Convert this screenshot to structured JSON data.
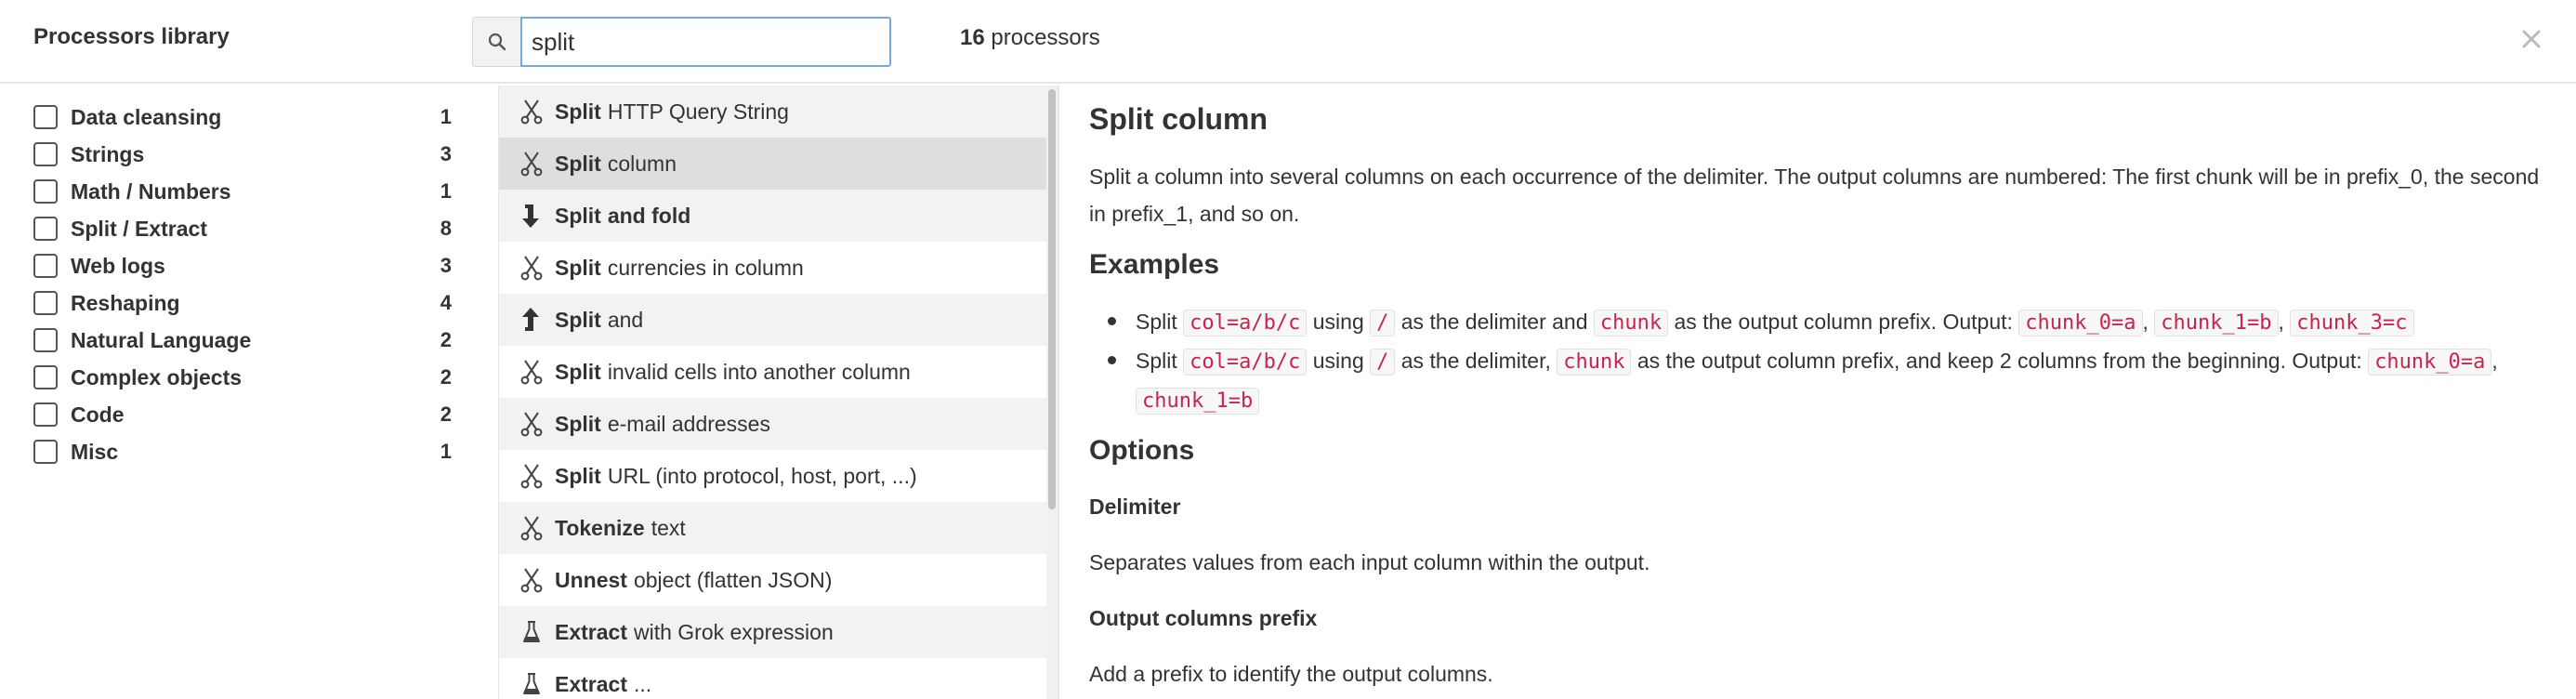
{
  "header": {
    "title": "Processors library",
    "search": {
      "value": "split",
      "placeholder": ""
    },
    "count_number": "16",
    "count_label": "processors",
    "close_icon": "close-icon"
  },
  "categories": [
    {
      "label": "Data cleansing",
      "count": "1"
    },
    {
      "label": "Strings",
      "count": "3"
    },
    {
      "label": "Math / Numbers",
      "count": "1"
    },
    {
      "label": "Split / Extract",
      "count": "8"
    },
    {
      "label": "Web logs",
      "count": "3"
    },
    {
      "label": "Reshaping",
      "count": "4"
    },
    {
      "label": "Natural Language",
      "count": "2"
    },
    {
      "label": "Complex objects",
      "count": "2"
    },
    {
      "label": "Code",
      "count": "2"
    },
    {
      "label": "Misc",
      "count": "1"
    }
  ],
  "processors": [
    {
      "bold": "Split",
      "rest": "HTTP Query String",
      "icon": "scissors-icon"
    },
    {
      "bold": "Split",
      "rest": "column",
      "icon": "scissors-icon"
    },
    {
      "bold": "Split",
      "rest": "and fold",
      "rest_bold": true,
      "icon": "arrow-down-icon"
    },
    {
      "bold": "Split",
      "rest": "currencies in column",
      "icon": "scissors-icon"
    },
    {
      "bold": "Split",
      "rest": "and",
      "icon": "arrow-up-icon"
    },
    {
      "bold": "Split",
      "rest": "invalid cells into another column",
      "icon": "scissors-icon"
    },
    {
      "bold": "Split",
      "rest": "e-mail addresses",
      "icon": "scissors-icon"
    },
    {
      "bold": "Split",
      "rest": "URL (into protocol, host, port, ...)",
      "icon": "scissors-icon"
    },
    {
      "bold": "Tokenize",
      "rest": "text",
      "icon": "scissors-icon"
    },
    {
      "bold": "Unnest",
      "rest": "object (flatten JSON)",
      "icon": "scissors-icon"
    },
    {
      "bold": "Extract",
      "rest": "with Grok expression",
      "icon": "flask-icon"
    },
    {
      "bold": "Extract",
      "rest": "...",
      "icon": "flask-icon"
    }
  ],
  "detail": {
    "title": "Split column",
    "description": "Split a column into several columns on each occurrence of the delimiter. The output columns are numbered: The first chunk will be in prefix_0, the second in prefix_1, and so on.",
    "examples_heading": "Examples",
    "examples": {
      "e1": {
        "t1": "Split",
        "c1": "col=a/b/c",
        "t2": "using",
        "c2": "/",
        "t3": "as the delimiter and",
        "c3": "chunk",
        "t4": "as the output column prefix. Output:",
        "c4": "chunk_0=a",
        "c5": "chunk_1=b",
        "c6": "chunk_3=c",
        "sep": ","
      },
      "e2": {
        "t1": "Split",
        "c1": "col=a/b/c",
        "t2": "using",
        "c2": "/",
        "t3": "as the delimiter,",
        "c3": "chunk",
        "t4": "as the output column prefix, and keep 2 columns from the beginning. Output:",
        "c4": "chunk_0=a",
        "c5": "chunk_1=b",
        "sep": ","
      }
    },
    "options_heading": "Options",
    "options": [
      {
        "name": "Delimiter",
        "description": "Separates values from each input column within the output."
      },
      {
        "name": "Output columns prefix",
        "description": "Add a prefix to identify the output columns."
      }
    ]
  }
}
